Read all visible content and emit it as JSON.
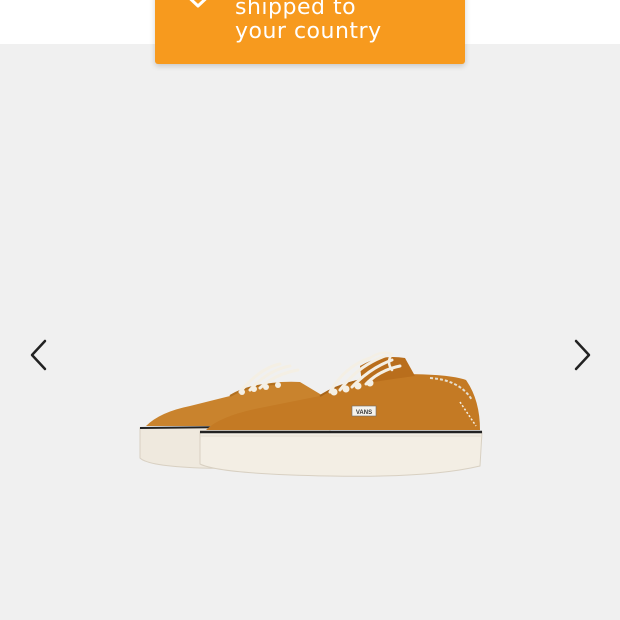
{
  "toast": {
    "line1": "shipped to",
    "line2": "your country",
    "icon": "warning-icon",
    "background": "#f79a1e"
  },
  "gallery": {
    "prev_icon": "chevron-left-icon",
    "next_icon": "chevron-right-icon",
    "product_image": "sneaker-image",
    "background": "#f0f0f0"
  },
  "product_image": {
    "label_text": "VANS"
  }
}
